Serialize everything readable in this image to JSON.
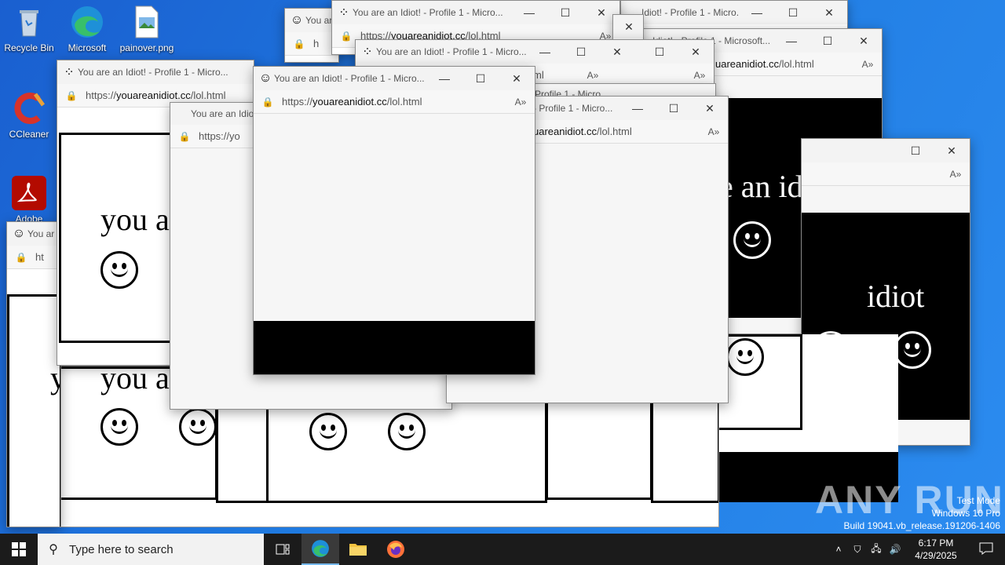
{
  "desktop": {
    "icons": [
      {
        "label": "Recycle Bin"
      },
      {
        "label": "Microsoft"
      },
      {
        "label": "painover.png"
      },
      {
        "label": "CCleaner"
      },
      {
        "label": "Adobe"
      }
    ]
  },
  "browser": {
    "title_full": "You are an Idiot! - Profile 1 - Micro...",
    "title_full2": "You are an Idiot! - Profile 1 - Microsoft...",
    "title_tail": "Idiot! - Profile 1 - Micro...",
    "title_tail2": "- Profile 1 - Micro...",
    "title_stub": "You are an Idiot",
    "title_stub2": "You ar",
    "title_stub3": "You are",
    "title_trunc": "Profile 1 - Micro",
    "title_trunc2": "Idiot! - Profile 1 - Microsoft...",
    "url_prefix": "https://",
    "url_domain": "youareanidiot.cc",
    "url_path": "/lol.html",
    "url_tail_domain": "uareanidiot.cc",
    "url_stub": "https://yo",
    "url_stub2": "h",
    "url_stub3": "ht",
    "url_stub4": "ml"
  },
  "page": {
    "text": "you are an idiot",
    "text_frag1": "you a",
    "text_frag2": "e an idiot",
    "text_frag3": "idiot",
    "text_frag4": "y"
  },
  "taskbar": {
    "search_placeholder": "Type here to search",
    "time": "6:17 PM",
    "date": "4/29/2025"
  },
  "watermark": {
    "line1": "Test Mode",
    "line2": "Windows 10 Pro",
    "line3": "Build 19041.vb_release.191206-1406",
    "brand": "ANY RUN"
  },
  "colors": {
    "taskbar": "#1b1b1b",
    "desktop_accent": "#1f7ae0",
    "edge_active_underline": "#76b9ed"
  }
}
